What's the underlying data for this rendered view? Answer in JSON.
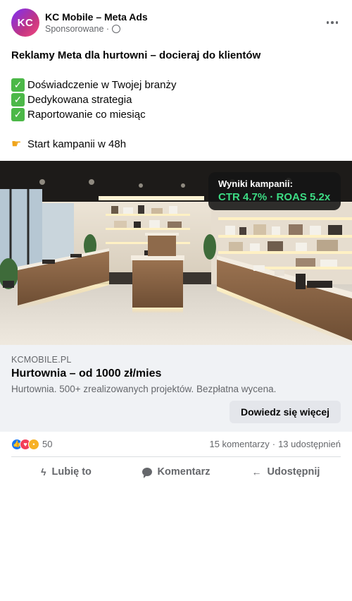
{
  "header": {
    "avatar_text": "KC",
    "page_name": "KC Mobile – Meta Ads",
    "sponsored": "Sponsorowane ·",
    "globe_icon": "globe-icon",
    "more_icon": "more-dots-icon"
  },
  "post": {
    "headline": "Reklamy Meta dla hurtowni – docieraj do klientów",
    "bullets": [
      {
        "icon": "check-emoji",
        "text": "Doświadczenie w Twojej branży"
      },
      {
        "icon": "check-emoji",
        "text": "Dedykowana strategia"
      },
      {
        "icon": "check-emoji",
        "text": "Raportowanie co miesiąc"
      }
    ],
    "cta_line": {
      "icon": "pointing-hand-emoji",
      "text": "Start kampanii w 48h"
    }
  },
  "image": {
    "overlay_title": "Wyniki kampanii:",
    "overlay_stats": "CTR 4.7% · ROAS 5.2x"
  },
  "link": {
    "domain": "KCMOBILE.PL",
    "title": "Hurtownia – od 1000 zł/mies",
    "description": "Hurtownia. 500+ zrealizowanych projektów. Bezpłatna wycena.",
    "cta_label": "Dowiedz się więcej"
  },
  "reactions": {
    "icons": [
      "like-reaction-icon",
      "love-reaction-icon",
      "wow-reaction-icon"
    ],
    "count": "50",
    "comments": "15 komentarzy",
    "separator": "·",
    "shares": "13 udostępnień"
  },
  "actions": [
    {
      "label": "Lubię to",
      "icon": "like-icon"
    },
    {
      "label": "Komentarz",
      "icon": "comment-icon"
    },
    {
      "label": "Udostępnij",
      "icon": "share-icon"
    }
  ],
  "colors": {
    "avatar_gradient_start": "#7b2ff7",
    "avatar_gradient_end": "#f5487f",
    "stats_green": "#3ddc84",
    "link_bg": "#f0f2f5",
    "muted_text": "#65676b"
  }
}
